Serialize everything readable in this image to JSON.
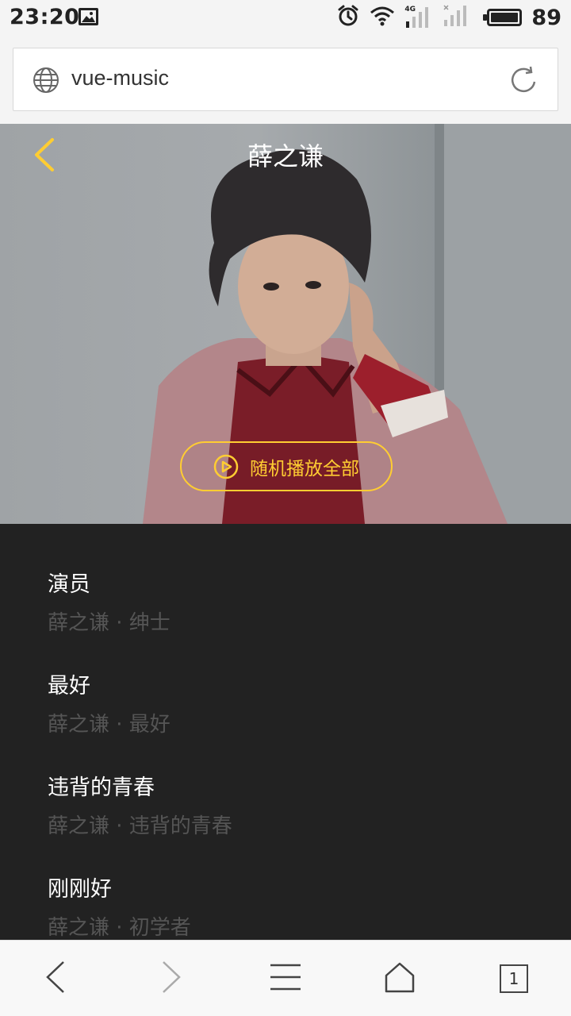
{
  "status_bar": {
    "time": "23:20",
    "network_label": "4G",
    "battery_level": "89",
    "icons": [
      "image-icon",
      "alarm-icon",
      "wifi-icon",
      "signal-icon",
      "no-signal-icon",
      "battery-icon"
    ]
  },
  "browser": {
    "url": "vue-music",
    "icons": [
      "globe-icon",
      "reload-icon"
    ],
    "tab_count": "1"
  },
  "singer": {
    "name": "薛之谦",
    "random_play_label": "随机播放全部",
    "accent_color": "#ffcd32"
  },
  "songs": [
    {
      "name": "演员",
      "desc": "薛之谦 · 绅士"
    },
    {
      "name": "最好",
      "desc": "薛之谦 · 最好"
    },
    {
      "name": "违背的青春",
      "desc": "薛之谦 · 违背的青春"
    },
    {
      "name": "刚刚好",
      "desc": "薛之谦 · 初学者"
    }
  ],
  "colors": {
    "background": "#222222",
    "song_name": "#ffffff",
    "song_desc": "#555555",
    "accent": "#ffcd32"
  }
}
